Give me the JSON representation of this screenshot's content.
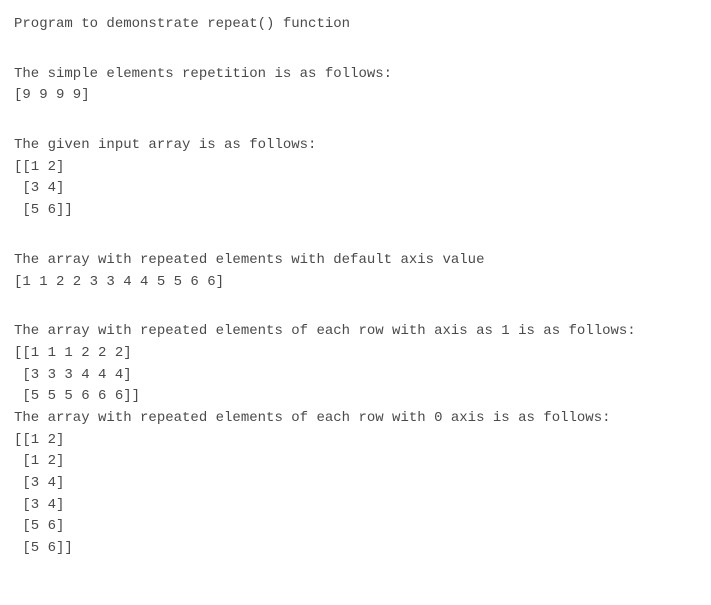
{
  "title": "Program to demonstrate repeat() function",
  "section1": {
    "heading": "The simple elements repetition is as follows:",
    "array": "[9 9 9 9]"
  },
  "section2": {
    "heading": "The given input array is as follows:",
    "row0": "[[1 2]",
    "row1": " [3 4]",
    "row2": " [5 6]]"
  },
  "section3": {
    "heading": "The array with repeated elements with default axis value",
    "array": "[1 1 2 2 3 3 4 4 5 5 6 6]"
  },
  "section4": {
    "heading": "The array with repeated elements of each row with axis as 1 is as follows:",
    "row0": "[[1 1 1 2 2 2]",
    "row1": " [3 3 3 4 4 4]",
    "row2": " [5 5 5 6 6 6]]"
  },
  "section5": {
    "heading": "The array with repeated elements of each row with 0 axis is as follows:",
    "row0": "[[1 2]",
    "row1": " [1 2]",
    "row2": " [3 4]",
    "row3": " [3 4]",
    "row4": " [5 6]",
    "row5": " [5 6]]"
  }
}
